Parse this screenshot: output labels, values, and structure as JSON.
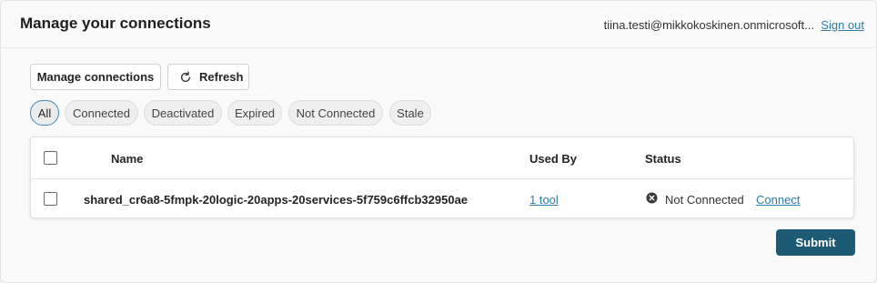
{
  "header": {
    "title": "Manage your connections",
    "user_email": "tiina.testi@mikkokoskinen.onmicrosoft...",
    "sign_out": "Sign out"
  },
  "toolbar": {
    "manage_label": "Manage connections",
    "refresh_label": "Refresh",
    "refresh_icon": "refresh-icon"
  },
  "filters": [
    {
      "label": "All",
      "active": true
    },
    {
      "label": "Connected",
      "active": false
    },
    {
      "label": "Deactivated",
      "active": false
    },
    {
      "label": "Expired",
      "active": false
    },
    {
      "label": "Not Connected",
      "active": false
    },
    {
      "label": "Stale",
      "active": false
    }
  ],
  "table": {
    "columns": [
      "Name",
      "Used By",
      "Status"
    ],
    "rows": [
      {
        "name": "shared_cr6a8-5fmpk-20logic-20apps-20services-5f759c6ffcb32950ae",
        "used_by": "1 tool",
        "status": "Not Connected",
        "status_icon": "error-circle-icon",
        "action": "Connect"
      }
    ]
  },
  "footer": {
    "submit_label": "Submit"
  },
  "colors": {
    "accent": "#2c7ca3",
    "primary_button": "#1d5a73",
    "active_filter_border": "#3b8bbd"
  }
}
